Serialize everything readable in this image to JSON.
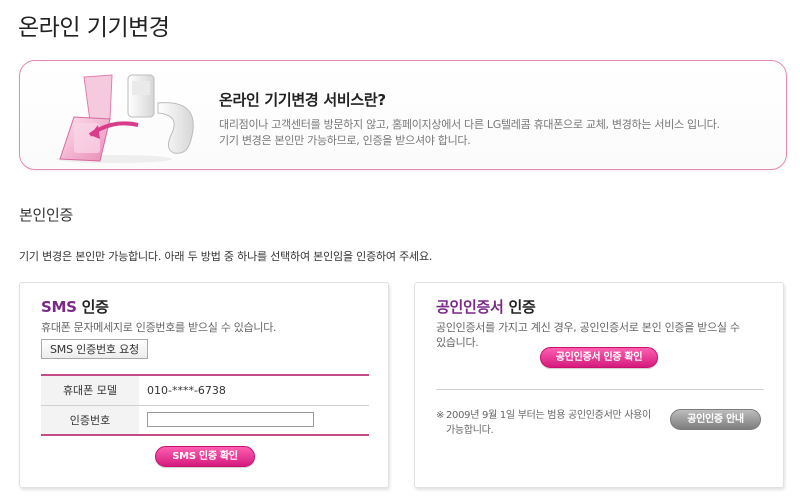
{
  "page": {
    "title": "온라인 기기변경"
  },
  "intro": {
    "title": "온라인 기기변경 서비스란?",
    "line1": "대리점이나 고객센터를 방문하지 않고, 홈페이지상에서 다른 LG텔레콤 휴대폰으로 교체, 변경하는 서비스 입니다.",
    "line2": "기기 변경은 본인만 가능하므로, 인증을 받으셔야 합니다."
  },
  "auth_section": {
    "title": "본인인증",
    "desc": "기기 변경은 본인만 가능합니다. 아래 두 방법 중 하나를 선택하여 본인임을 인증하여 주세요."
  },
  "sms": {
    "title_accent": "SMS",
    "title_rest": " 인증",
    "desc": "휴대폰 문자메세지로 인증번호를 받으실 수 있습니다.",
    "request_button": "SMS 인증번호 요청",
    "phone_label": "휴대폰 모델",
    "phone_value": "010-****-6738",
    "code_label": "인증번호",
    "code_value": "",
    "confirm_button": "SMS 인증 확인"
  },
  "cert": {
    "title_accent": "공인인증서",
    "title_rest": " 인증",
    "desc_line1": "공인인증서를 가지고 계신 경우,  공인인증서로 본인 인증을 받으실 수",
    "desc_line2": "있습니다.",
    "confirm_button": "공인인증서 인증 확인",
    "note_mark": "※",
    "note": "2009년 9월 1일 부터는 범용 공인인증서만 사용이 가능합니다.",
    "guide_button": "공인인증 안내"
  },
  "colors": {
    "accent": "#7a2a86",
    "pink_button": "#d41b7e",
    "box_border": "#e48bb2"
  },
  "icons": {
    "illustration": "phones-illustration-icon"
  }
}
